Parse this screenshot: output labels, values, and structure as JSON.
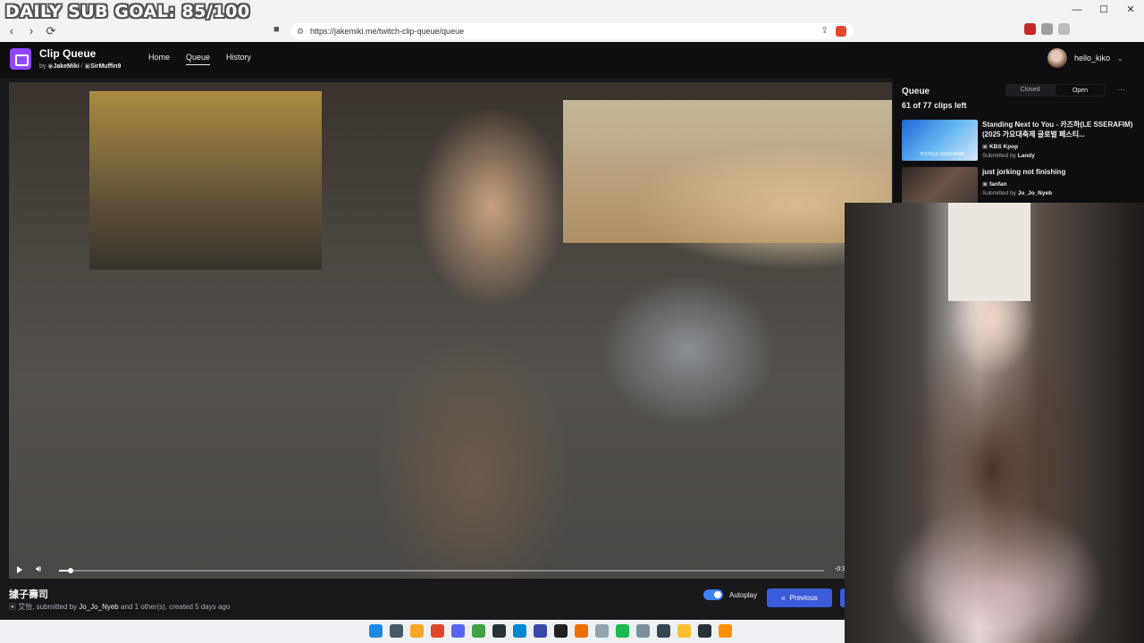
{
  "overlay": {
    "goal_text": "DAILY SUB GOAL: 85/100"
  },
  "browser": {
    "url": "https://jakemiki.me/twitch-clip-queue/queue",
    "window_controls": [
      "—",
      "☐",
      "✕"
    ]
  },
  "app": {
    "title": "Clip Queue",
    "by_prefix": "by",
    "author1": "JakeMiki",
    "author2": "SirMuffin9",
    "nav": [
      {
        "label": "Home",
        "active": false
      },
      {
        "label": "Queue",
        "active": true
      },
      {
        "label": "History",
        "active": false
      }
    ],
    "user": {
      "name": "hello_kiko"
    }
  },
  "player": {
    "time": "-0:3",
    "progress": 0.015
  },
  "clip": {
    "title": "據子壽司",
    "channel": "艾怡",
    "submitted_prefix": ", submitted by",
    "submitter": "Jo_Jo_Nyeb",
    "submitted_suffix": "and 1 other(s), created 5 days ago"
  },
  "controls": {
    "autoplay_label": "Autoplay",
    "autoplay_on": true,
    "previous_label": "Previous"
  },
  "queue": {
    "title": "Queue",
    "count_text": "61 of 77 clips left",
    "tabs": [
      {
        "label": "Closed",
        "active": false
      },
      {
        "label": "Open",
        "active": true
      }
    ],
    "items": [
      {
        "title": "Standing Next to You - 카즈하(LE SSERAFIM) (2025 가요대축제 글로벌 페스티...",
        "channel": "KBS Kpop",
        "submitted_prefix": "Submitted by",
        "submitter": "Landy",
        "thumb_caption": "카즈하(LE SSERAFIM)"
      },
      {
        "title": "just jorking not finishing",
        "channel": "fanfan",
        "submitted_prefix": "Submitted by",
        "submitter": "Jo_Jo_Nyeb",
        "thumb_caption": ""
      }
    ]
  },
  "colors": {
    "accent": "#9147ff",
    "primary_button": "#3b5bdb",
    "toggle": "#3b82f6"
  }
}
